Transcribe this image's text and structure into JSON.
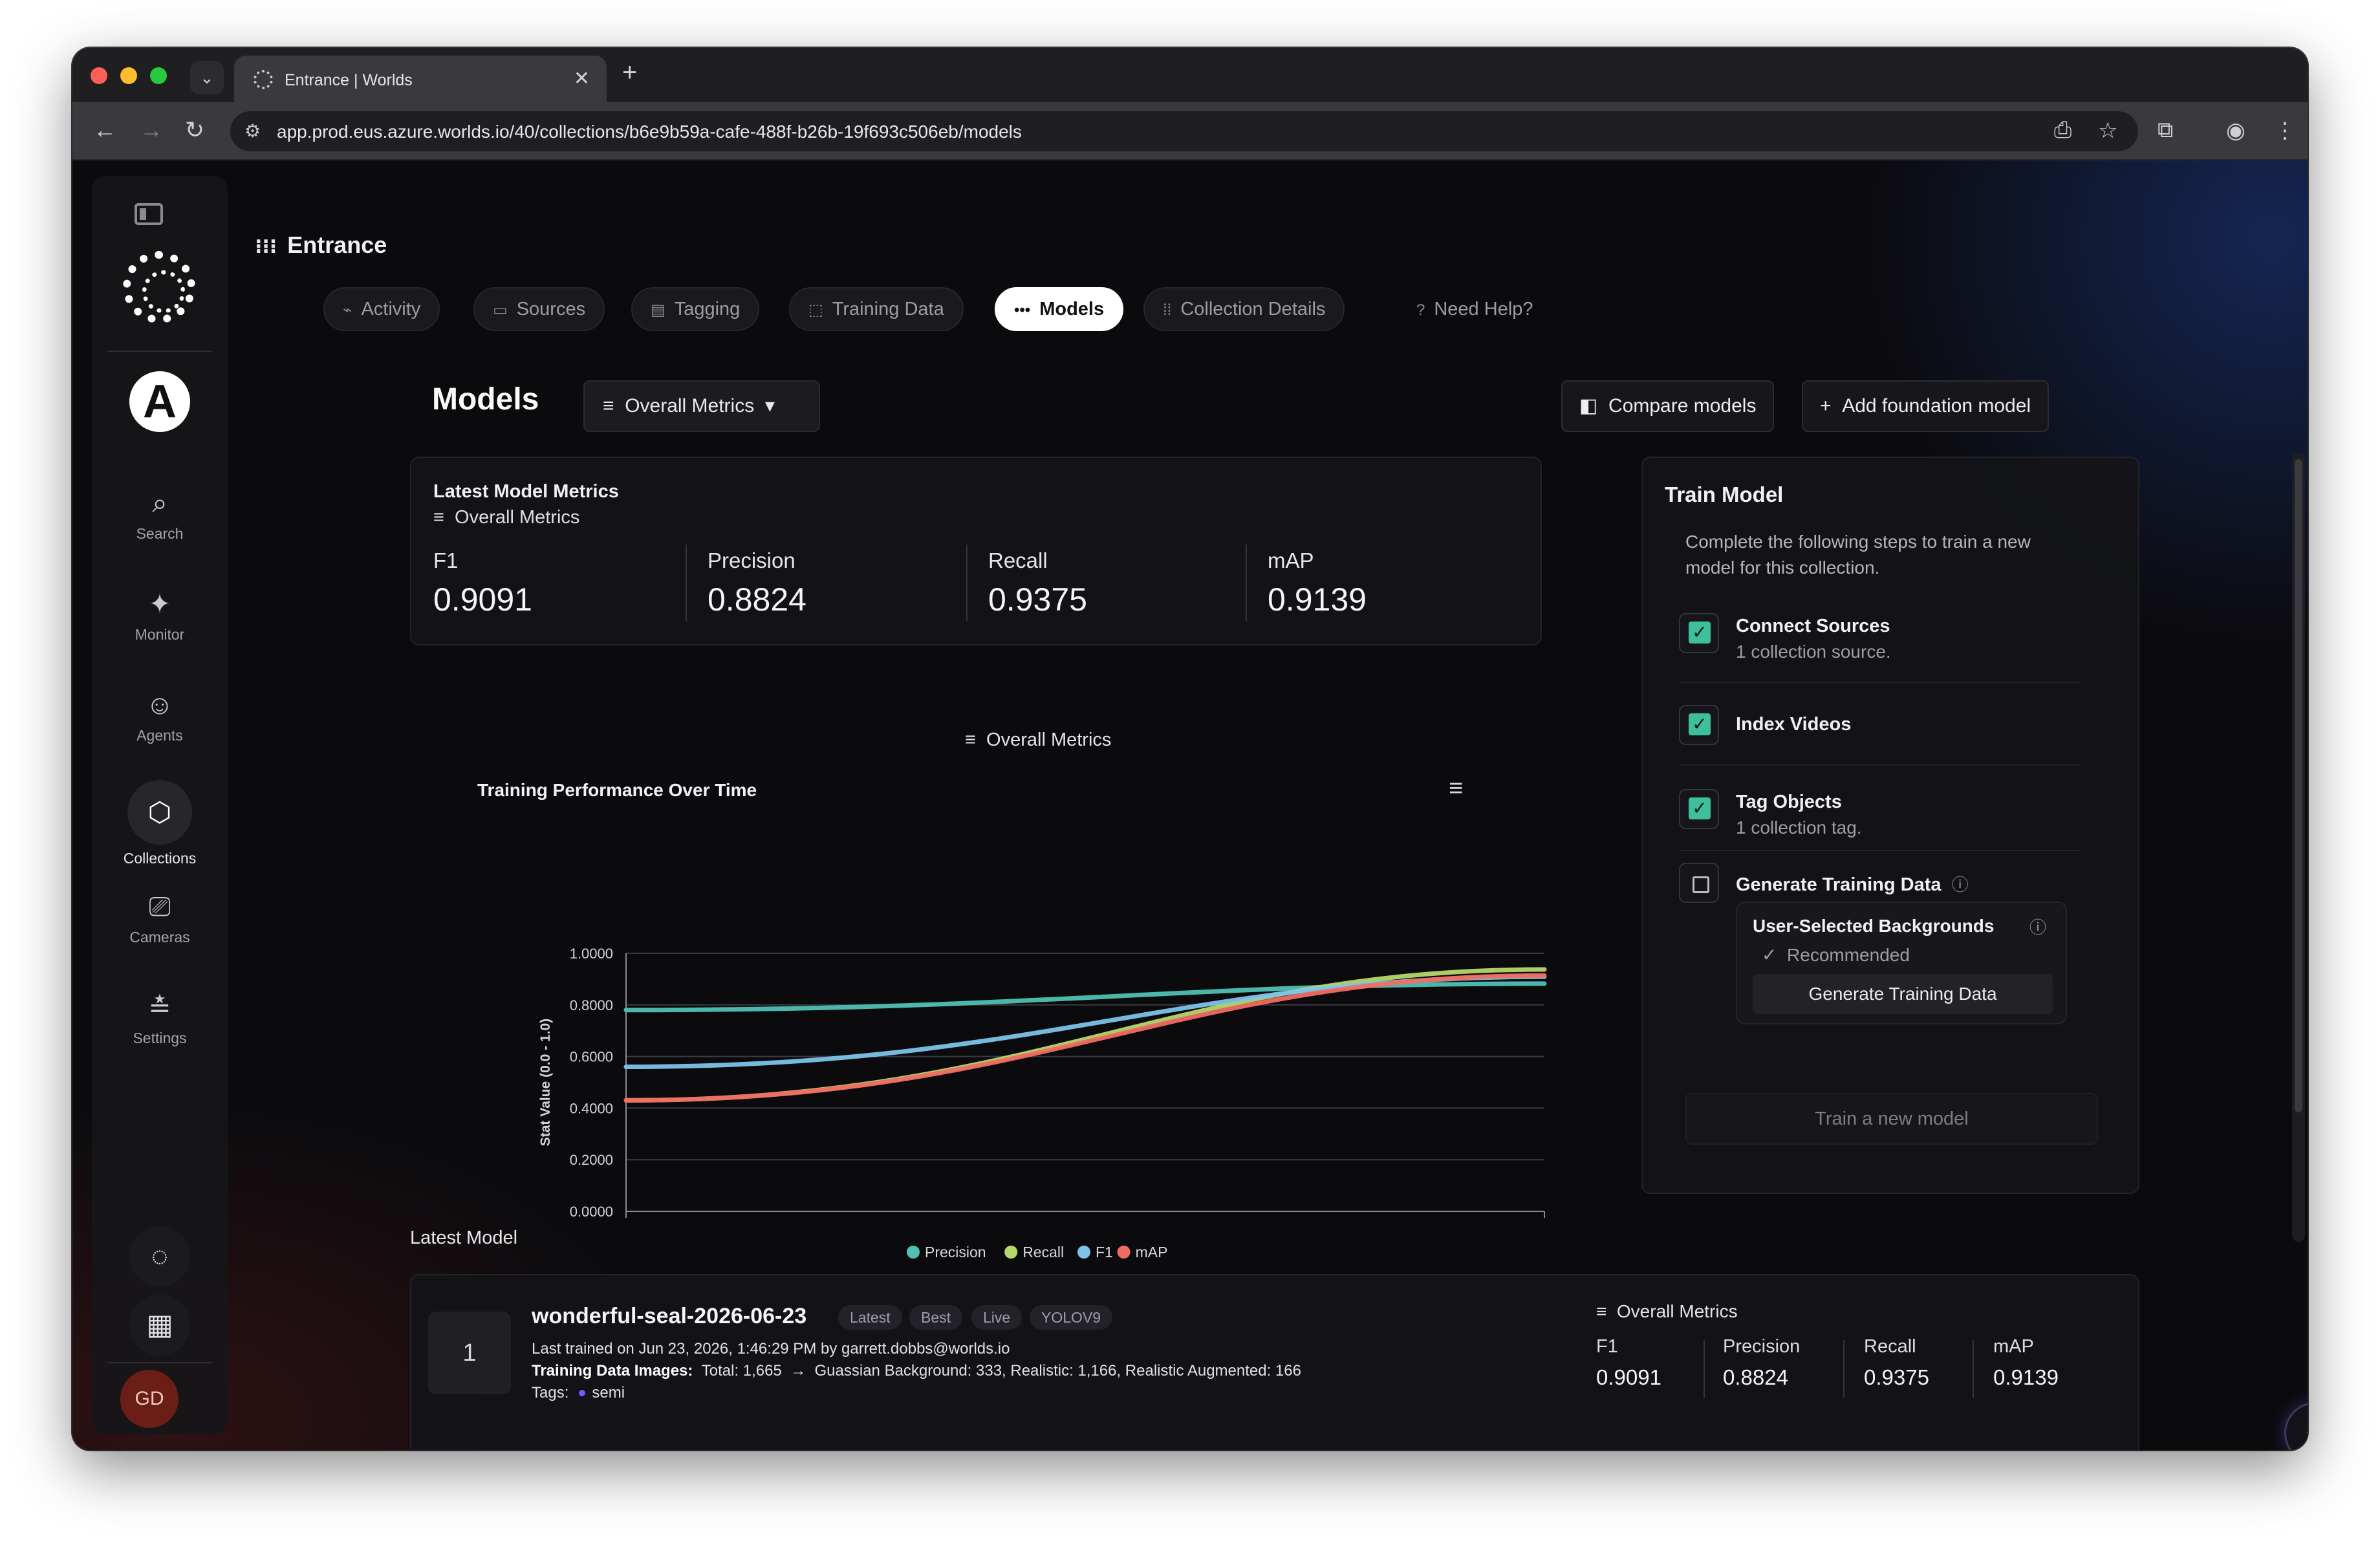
{
  "browser": {
    "tab_title": "Entrance | Worlds",
    "url": "app.prod.eus.azure.worlds.io/40/collections/b6e9b59a-cafe-488f-b26b-19f693c506eb/models",
    "close_glyph": "✕",
    "new_tab_glyph": "+",
    "tab_arrow_glyph": "⌄"
  },
  "sidebar": {
    "org_initial": "A",
    "items": [
      {
        "label": "Search",
        "icon": "search-icon",
        "glyph": "⌕"
      },
      {
        "label": "Monitor",
        "icon": "monitor-icon",
        "glyph": "✦"
      },
      {
        "label": "Agents",
        "icon": "agent-icon",
        "glyph": "☺"
      },
      {
        "label": "Collections",
        "icon": "collections-icon",
        "glyph": "⬡"
      },
      {
        "label": "Cameras",
        "icon": "camera-icon",
        "glyph": "⎚"
      },
      {
        "label": "Settings",
        "icon": "settings-icon",
        "glyph": "≛"
      }
    ],
    "user_initials": "GD"
  },
  "header": {
    "title": "Entrance",
    "tabs": [
      {
        "label": "Activity",
        "glyph": "⌁"
      },
      {
        "label": "Sources",
        "glyph": "▭"
      },
      {
        "label": "Tagging",
        "glyph": "▤"
      },
      {
        "label": "Training Data",
        "glyph": "⬚"
      },
      {
        "label": "Models",
        "glyph": "•••"
      },
      {
        "label": "Collection Details",
        "glyph": "⁞⁞"
      },
      {
        "label": "Need Help?",
        "glyph": "?"
      }
    ]
  },
  "models": {
    "title": "Models",
    "metric_select": "Overall Metrics",
    "compare_label": "Compare models",
    "add_foundation_label": "Add foundation model"
  },
  "latest_metrics": {
    "title": "Latest Model Metrics",
    "subtitle": "Overall Metrics",
    "items": [
      {
        "label": "F1",
        "value": "0.9091"
      },
      {
        "label": "Precision",
        "value": "0.8824"
      },
      {
        "label": "Recall",
        "value": "0.9375"
      },
      {
        "label": "mAP",
        "value": "0.9139"
      }
    ]
  },
  "chart_caption": "Overall Metrics",
  "chart_data": {
    "type": "line",
    "title": "Training Performance Over Time",
    "xlabel": "",
    "ylabel": "Stat Value (0.0 - 1.0)",
    "ylim": [
      0,
      1
    ],
    "yticks": [
      "1.0000",
      "0.8000",
      "0.6000",
      "0.4000",
      "0.2000",
      "0.0000"
    ],
    "x": [
      0,
      1
    ],
    "grid": true,
    "legend_position": "bottom",
    "series": [
      {
        "name": "Precision",
        "color": "#4fc1b4",
        "start": 0.78,
        "end": 0.8824
      },
      {
        "name": "Recall",
        "color": "#b5d86a",
        "start": 0.43,
        "end": 0.9375
      },
      {
        "name": "F1",
        "color": "#7cc3e8",
        "start": 0.56,
        "end": 0.9091
      },
      {
        "name": "mAP",
        "color": "#f06b63",
        "start": 0.43,
        "end": 0.9139
      }
    ]
  },
  "train_model": {
    "title": "Train Model",
    "intro_line1": "Complete the following steps to train a new",
    "intro_line2": "model for this collection.",
    "steps": [
      {
        "name": "Connect Sources",
        "desc": "1 collection source.",
        "checked": true
      },
      {
        "name": "Index Videos",
        "desc": "",
        "checked": true
      },
      {
        "name": "Tag Objects",
        "desc": "1 collection tag.",
        "checked": true
      },
      {
        "name": "Generate Training Data",
        "desc": "",
        "checked": false
      }
    ],
    "background_option": "User-Selected Backgrounds",
    "recommended": "Recommended",
    "generate_button": "Generate Training Data",
    "train_button": "Train a new model"
  },
  "latest_model": {
    "section_label": "Latest Model",
    "rank": "1",
    "name": "wonderful-seal-2026-06-23",
    "badges": [
      "Latest",
      "Best",
      "Live",
      "YOLOV9"
    ],
    "trained_line": "Last trained on Jun 23, 2026, 1:46:29 PM by garrett.dobbs@worlds.io",
    "images_label": "Training Data Images:",
    "images_total": "Total: 1,665",
    "images_detail": "Guassian Background: 333,  Realistic: 1,166,  Realistic Augmented: 166",
    "tags_label": "Tags:",
    "tag": "semi",
    "metrics_title": "Overall Metrics",
    "metrics": [
      {
        "label": "F1",
        "value": "0.9091"
      },
      {
        "label": "Precision",
        "value": "0.8824"
      },
      {
        "label": "Recall",
        "value": "0.9375"
      },
      {
        "label": "mAP",
        "value": "0.9139"
      }
    ]
  },
  "colors": {
    "accent_check": "#3dbf9b",
    "background": "#0b0b0e"
  }
}
